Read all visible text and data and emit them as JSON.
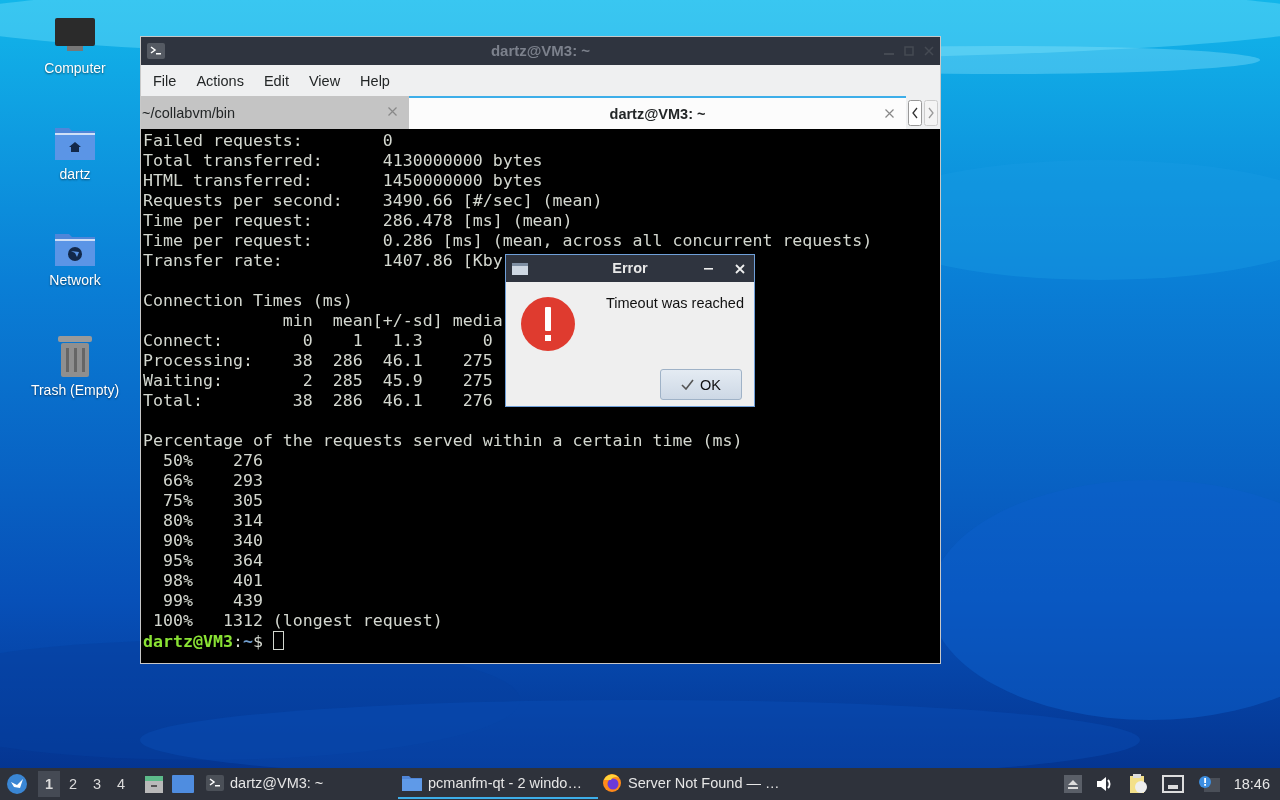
{
  "desktop_icons": [
    {
      "label": "Computer",
      "kind": "computer"
    },
    {
      "label": "dartz",
      "kind": "home"
    },
    {
      "label": "Network",
      "kind": "network"
    },
    {
      "label": "Trash (Empty)",
      "kind": "trash"
    }
  ],
  "terminal": {
    "title": "dartz@VM3: ~",
    "menu": [
      "File",
      "Actions",
      "Edit",
      "View",
      "Help"
    ],
    "tabs": [
      {
        "label": "~/collabvm/bin",
        "selected": false
      },
      {
        "label": "dartz@VM3: ~",
        "selected": true
      }
    ],
    "blocks": [
      [
        "Failed requests:        0",
        "Total transferred:      4130000000 bytes",
        "HTML transferred:       1450000000 bytes",
        "Requests per second:    3490.66 [#/sec] (mean)",
        "Time per request:       286.478 [ms] (mean)",
        "Time per request:       0.286 [ms] (mean, across all concurrent requests)",
        "Transfer rate:          1407.86 [Kby"
      ],
      [
        "Connection Times (ms)",
        "              min  mean[+/-sd] media",
        "Connect:        0    1   1.3      0",
        "Processing:    38  286  46.1    275",
        "Waiting:        2  285  45.9    275",
        "Total:         38  286  46.1    276"
      ],
      [
        "Percentage of the requests served within a certain time (ms)",
        "  50%    276",
        "  66%    293",
        "  75%    305",
        "  80%    314",
        "  90%    340",
        "  95%    364",
        "  98%    401",
        "  99%    439",
        " 100%   1312 (longest request)"
      ]
    ],
    "prompt": {
      "user_host": "dartz@VM3",
      "separator": ":",
      "path": "~",
      "symbol": "$"
    }
  },
  "dialog": {
    "title": "Error",
    "message": "Timeout was reached",
    "button": "OK"
  },
  "taskbar": {
    "workspaces": [
      {
        "label": "1",
        "selected": true
      },
      {
        "label": "2",
        "selected": false
      },
      {
        "label": "3",
        "selected": false
      },
      {
        "label": "4",
        "selected": false
      }
    ],
    "tasks": [
      {
        "label": "dartz@VM3: ~",
        "kind": "terminal",
        "selected": false
      },
      {
        "label": "pcmanfm-qt - 2 windo…",
        "kind": "folder",
        "selected": true
      },
      {
        "label": "Server Not Found — …",
        "kind": "browser",
        "selected": false
      }
    ],
    "clock": "18:46"
  }
}
